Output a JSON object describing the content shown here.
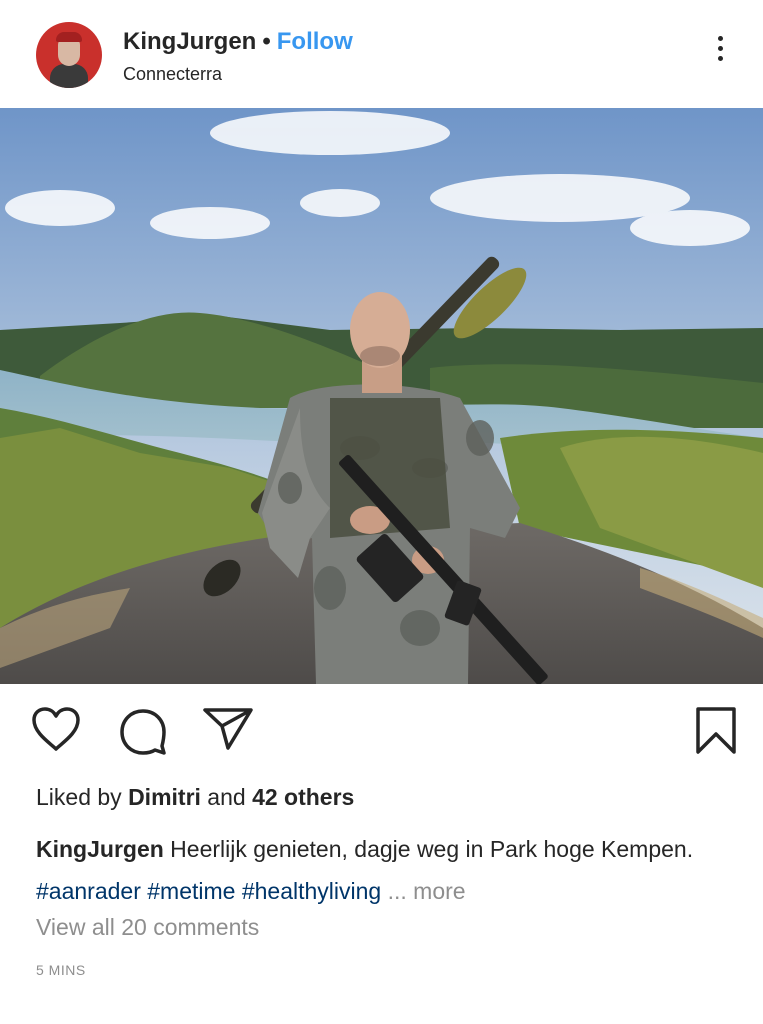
{
  "header": {
    "username": "KingJurgen",
    "separator": "•",
    "follow_label": "Follow",
    "location": "Connecterra",
    "more_icon": "more-vertical-icon"
  },
  "post": {
    "image_alt_icon": "photo"
  },
  "actions": {
    "icons": [
      "heart-icon",
      "comment-icon",
      "share-icon",
      "bookmark-icon"
    ]
  },
  "likes": {
    "prefix": "Liked by ",
    "user": "Dimitri",
    "middle": " and ",
    "others": "42 others"
  },
  "caption": {
    "username": "KingJurgen",
    "text": " Heerlijk genieten, dagje weg in Park hoge Kempen. ",
    "hashtags": "#aanrader #metime #healthyliving",
    "more": " ... more"
  },
  "comments_link": "View all 20 comments",
  "timestamp": "5 MINS",
  "colors": {
    "link_blue": "#3897f0",
    "hashtag": "#003569",
    "muted": "#8e8e8e",
    "text": "#262626"
  }
}
